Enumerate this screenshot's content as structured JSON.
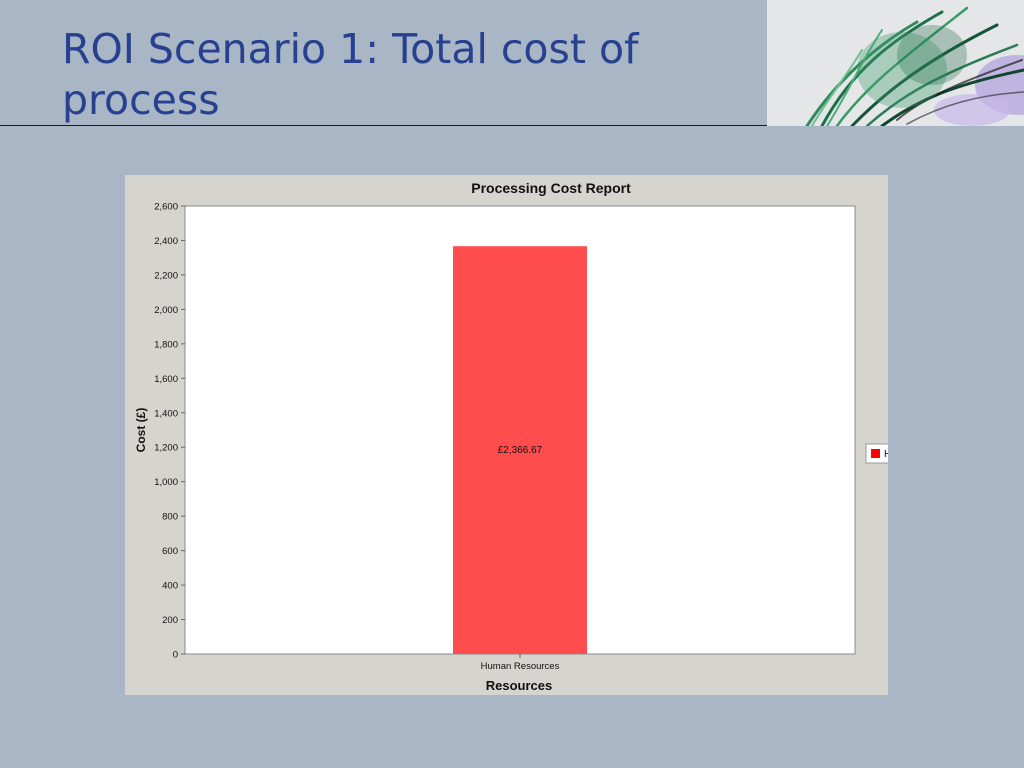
{
  "slide": {
    "title": "ROI Scenario 1: Total cost of process"
  },
  "colors": {
    "background": "#a8b6c6",
    "title": "#27408f",
    "bar": "#ff4d4d",
    "legend_swatch": "#ff0000",
    "chart_panel": "#d6d4cf"
  },
  "chart_data": {
    "type": "bar",
    "title": "Processing Cost Report",
    "xlabel": "Resources",
    "ylabel": "Cost (£)",
    "categories": [
      "Human Resources"
    ],
    "values": [
      2366.67
    ],
    "data_labels": [
      "£2,366.67"
    ],
    "ylim": [
      0,
      2600
    ],
    "yticks": [
      0,
      200,
      400,
      600,
      800,
      1000,
      1200,
      1400,
      1600,
      1800,
      2000,
      2200,
      2400,
      2600
    ],
    "ytick_labels": [
      "0",
      "200",
      "400",
      "600",
      "800",
      "1,000",
      "1,200",
      "1,400",
      "1,600",
      "1,800",
      "2,000",
      "2,200",
      "2,400",
      "2,600"
    ],
    "grid": false,
    "legend": {
      "placement": "right",
      "entries": [
        "H"
      ]
    }
  }
}
